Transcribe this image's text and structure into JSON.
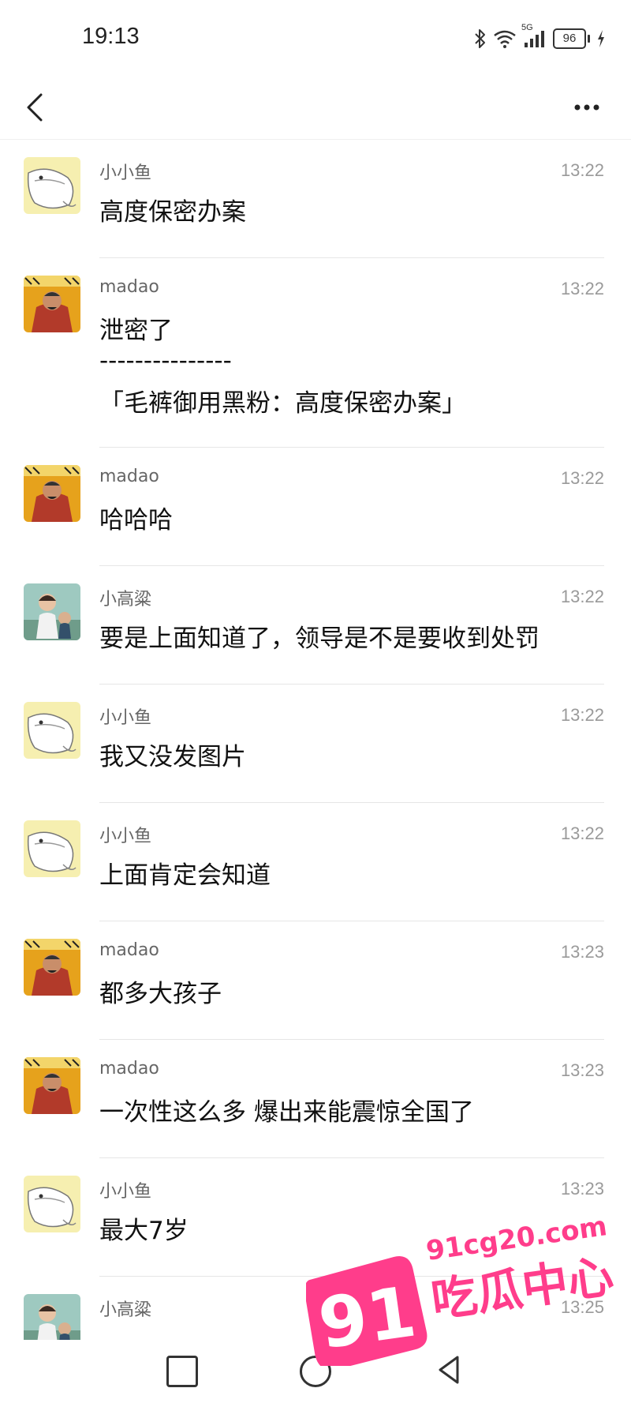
{
  "status_bar": {
    "time": "19:13",
    "network": "5G",
    "battery": "96",
    "icons": [
      "bluetooth-icon",
      "wifi-icon",
      "signal-icon",
      "battery-icon",
      "charging-icon"
    ]
  },
  "nav": {
    "back_icon": "chevron-left-icon",
    "more_icon": "more-dots-icon"
  },
  "messages": [
    {
      "sender": "小小鱼",
      "time": "13:22",
      "avatar": "fish",
      "lines": [
        "高度保密办案"
      ]
    },
    {
      "sender": "madao",
      "time": "13:22",
      "avatar": "madao",
      "lines": [
        "泄密了",
        "---------------",
        "「毛裤御用黑粉：高度保密办案」"
      ]
    },
    {
      "sender": "madao",
      "time": "13:22",
      "avatar": "madao",
      "lines": [
        "哈哈哈"
      ]
    },
    {
      "sender": "小高粱",
      "time": "13:22",
      "avatar": "kid",
      "lines": [
        "要是上面知道了，领导是不是要收到处罚"
      ]
    },
    {
      "sender": "小小鱼",
      "time": "13:22",
      "avatar": "fish",
      "lines": [
        "我又没发图片"
      ]
    },
    {
      "sender": "小小鱼",
      "time": "13:22",
      "avatar": "fish",
      "lines": [
        "上面肯定会知道"
      ]
    },
    {
      "sender": "madao",
      "time": "13:23",
      "avatar": "madao",
      "lines": [
        "都多大孩子"
      ]
    },
    {
      "sender": "madao",
      "time": "13:23",
      "avatar": "madao",
      "lines": [
        "一次性这么多  爆出来能震惊全国了"
      ]
    },
    {
      "sender": "小小鱼",
      "time": "13:23",
      "avatar": "fish",
      "lines": [
        "最大7岁"
      ]
    },
    {
      "sender": "小高粱",
      "time": "13:25",
      "avatar": "kid",
      "lines": []
    }
  ],
  "bottom_nav": {
    "icons": [
      "recent-apps-square-icon",
      "home-circle-icon",
      "back-triangle-icon"
    ]
  },
  "watermark": {
    "number": "91",
    "domain": "91cg20.com",
    "brand": "吃瓜中心",
    "color": "#ff3d8b"
  }
}
